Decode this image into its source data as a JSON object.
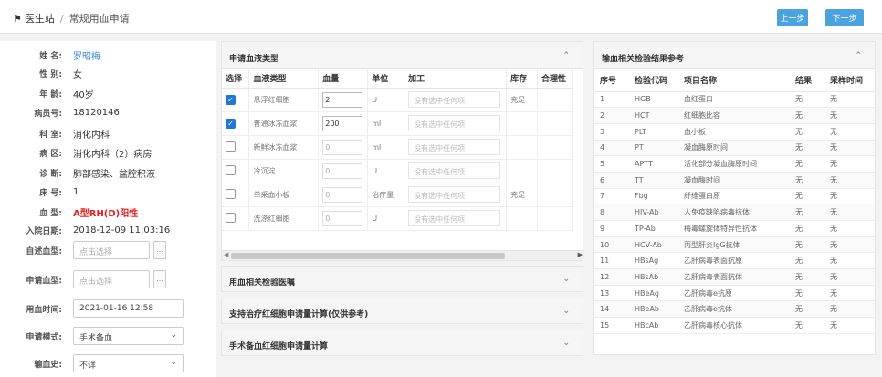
{
  "breadcrumb": {
    "home": "医生站",
    "separator": "/",
    "current": "常规用血申请"
  },
  "nav": {
    "prev_label": "上一步",
    "next_label": "下一步"
  },
  "patient": {
    "name_label": "姓 名:",
    "name": "罗昭梅",
    "gender_label": "性 别:",
    "gender": "女",
    "age_label": "年 龄:",
    "age": "40岁",
    "record_label": "病员号:",
    "record": "18120146",
    "dept_label": "科 室:",
    "dept": "消化内科",
    "ward_label": "病 区:",
    "ward": "消化内科（2）病房",
    "diag_label": "诊 断:",
    "diag": "肺部感染、盆腔积液",
    "bed_label": "床 号:",
    "bed": "1",
    "blood_label": "血 型:",
    "blood": "A型RH(D)阳性",
    "admit_label": "入院日期:",
    "admit": "2018-12-09 11:03:16"
  },
  "form": {
    "self_blood_label": "自述血型:",
    "self_blood_placeholder": "点击选择",
    "apply_blood_label": "申请血型:",
    "apply_blood_placeholder": "点击选择",
    "use_time_label": "用血时间:",
    "use_time": "2021-01-16 12:58",
    "apply_mode_label": "申请模式:",
    "apply_mode": "手术备血",
    "transfuse_label": "输血史:",
    "transfuse": "不详",
    "dots": "..."
  },
  "blood_panel": {
    "title": "申请血液类型",
    "headers": [
      "选择",
      "血液类型",
      "血量",
      "单位",
      "加工",
      "库存",
      "合理性"
    ],
    "proc_placeholder": "没有选中任何项",
    "rows": [
      {
        "checked": true,
        "type": "悬浮红细胞",
        "qty": "2",
        "unit": "U",
        "stock": "充足"
      },
      {
        "checked": true,
        "type": "普通冰冻血浆",
        "qty": "200",
        "unit": "ml",
        "stock": ""
      },
      {
        "checked": false,
        "type": "新鲜冰冻血浆",
        "qty": "0",
        "unit": "ml",
        "stock": ""
      },
      {
        "checked": false,
        "type": "冷沉淀",
        "qty": "0",
        "unit": "U",
        "stock": ""
      },
      {
        "checked": false,
        "type": "单采血小板",
        "qty": "0",
        "unit": "治疗量",
        "stock": "充足"
      },
      {
        "checked": false,
        "type": "洗涤红细胞",
        "qty": "0",
        "unit": "U",
        "stock": ""
      }
    ]
  },
  "collapsed": [
    "用血相关检验医嘱",
    "支持治疗红细胞申请量计算(仅供参考)",
    "手术备血红细胞申请量计算"
  ],
  "tests": {
    "title": "输血相关检验结果参考",
    "headers": [
      "序号",
      "检验代码",
      "项目名称",
      "结果",
      "采样时间"
    ],
    "rows": [
      [
        "1",
        "HGB",
        "血红蛋白",
        "无",
        "无"
      ],
      [
        "2",
        "HCT",
        "红细胞比容",
        "无",
        "无"
      ],
      [
        "3",
        "PLT",
        "血小板",
        "无",
        "无"
      ],
      [
        "4",
        "PT",
        "凝血酶原时间",
        "无",
        "无"
      ],
      [
        "5",
        "APTT",
        "活化部分凝血酶原时间",
        "无",
        "无"
      ],
      [
        "6",
        "TT",
        "凝血酶时间",
        "无",
        "无"
      ],
      [
        "7",
        "Fbg",
        "纤维蛋白原",
        "无",
        "无"
      ],
      [
        "8",
        "HIV-Ab",
        "人免疫缺陷病毒抗体",
        "无",
        "无"
      ],
      [
        "9",
        "TP-Ab",
        "梅毒螺旋体特异性抗体",
        "无",
        "无"
      ],
      [
        "10",
        "HCV-Ab",
        "丙型肝炎IgG抗体",
        "无",
        "无"
      ],
      [
        "11",
        "HBsAg",
        "乙肝病毒表面抗原",
        "无",
        "无"
      ],
      [
        "12",
        "HBsAb",
        "乙肝病毒表面抗体",
        "无",
        "无"
      ],
      [
        "13",
        "HBeAg",
        "乙肝病毒e抗原",
        "无",
        "无"
      ],
      [
        "14",
        "HBeAb",
        "乙肝病毒e抗体",
        "无",
        "无"
      ],
      [
        "15",
        "HBcAb",
        "乙肝病毒核心抗体",
        "无",
        "无"
      ]
    ]
  },
  "icons": {
    "home": "home-icon",
    "caret_up": "chevron-up-icon",
    "caret_down": "chevron-down-icon"
  }
}
